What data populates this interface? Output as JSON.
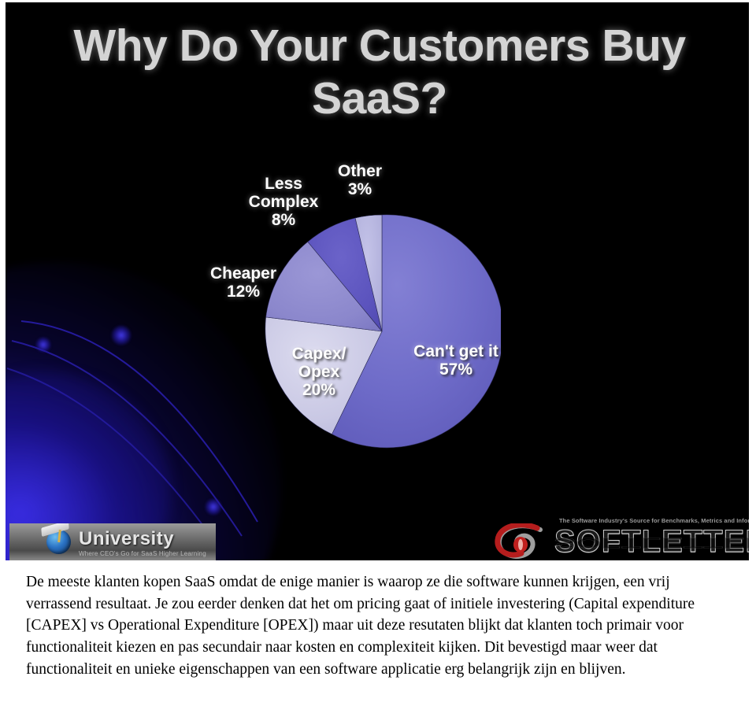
{
  "slide": {
    "title": "Why Do Your Customers Buy\nSaaS?",
    "background_color": "#000000",
    "glow_color": "#2214b5"
  },
  "chart_data": {
    "type": "pie",
    "title": "Why Do Your Customers Buy SaaS?",
    "categories": [
      "Can't get it",
      "Capex/Opex",
      "Cheaper",
      "Less Complex",
      "Other"
    ],
    "values": [
      57,
      20,
      12,
      8,
      3
    ],
    "unit": "%",
    "colors": [
      "#6e6bc8",
      "#c9c8e4",
      "#8b87cc",
      "#5b53bd",
      "#b3b2dd"
    ],
    "start_angle": 0,
    "direction": "clockwise",
    "legend": "none",
    "labels": [
      {
        "name": "cantget",
        "text": "Can't get it\n57%",
        "value": 57,
        "color": "#6e6bc8"
      },
      {
        "name": "capex",
        "text": "Capex/\nOpex\n20%",
        "value": 20,
        "color": "#c9c8e4"
      },
      {
        "name": "cheaper",
        "text": "Cheaper\n12%",
        "value": 12,
        "color": "#8b87cc"
      },
      {
        "name": "less-complex",
        "text": "Less\nComplex\n8%",
        "value": 8,
        "color": "#5b53bd"
      },
      {
        "name": "other",
        "text": "Other\n3%",
        "value": 3,
        "color": "#b3b2dd"
      }
    ]
  },
  "university_logo": {
    "name": "University",
    "tagline": "Where CEO's Go for SaaS Higher Learning"
  },
  "softletter_logo": {
    "tagline": "The Software Industry's Source for Benchmarks, Metrics and Information",
    "wordmark": "SOFTLETTER",
    "mark_color": "#b51d1d"
  },
  "body": {
    "paragraph": "De meeste klanten kopen SaaS omdat de enige manier is waarop ze die software kunnen krijgen, een vrij verrassend resultaat. Je zou eerder denken dat het om pricing gaat of initiele investering (Capital expenditure [CAPEX] vs Operational Expenditure [OPEX]) maar uit deze resutaten blijkt dat klanten toch primair voor functionaliteit kiezen en pas secundair naar kosten en complexiteit kijken. Dit bevestigd maar weer dat functionaliteit en unieke eigenschappen van een software applicatie erg belangrijk zijn en blijven."
  }
}
